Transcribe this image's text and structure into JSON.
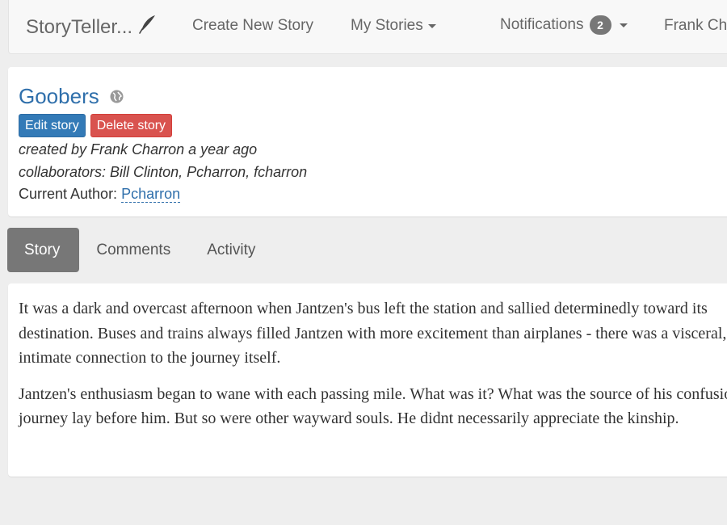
{
  "navbar": {
    "brand": "StoryTeller...",
    "create_story": "Create New Story",
    "my_stories": "My Stories",
    "notifications": "Notifications",
    "notification_count": "2",
    "user": "Frank Charron"
  },
  "story": {
    "title": "Goobers",
    "edit_label": "Edit story",
    "delete_label": "Delete story",
    "created_by": "created by Frank Charron a year ago",
    "collaborators": "collaborators: Bill Clinton, Pcharron, fcharron",
    "current_author_label": "Current Author:",
    "current_author": "Pcharron"
  },
  "tabs": [
    {
      "label": "Story",
      "active": true
    },
    {
      "label": "Comments",
      "active": false
    },
    {
      "label": "Activity",
      "active": false
    }
  ],
  "content": {
    "paragraphs": [
      "It was a dark and overcast afternoon when Jantzen's bus left the station and sallied determinedly toward its destination. Buses and trains always filled Jantzen with more excitement than airplanes - there was a visceral, intimate connection to the journey itself.",
      "Jantzen's enthusiasm began to wane with each passing mile. What was it? What was the source of his confusion. A journey lay before him. But so were other wayward souls. He didnt necessarily appreciate the kinship."
    ]
  },
  "colors": {
    "link": "#2f6fab",
    "primary_button": "#337ab7",
    "danger_button": "#d9534f",
    "active_tab": "#777777",
    "badge": "#777777"
  }
}
